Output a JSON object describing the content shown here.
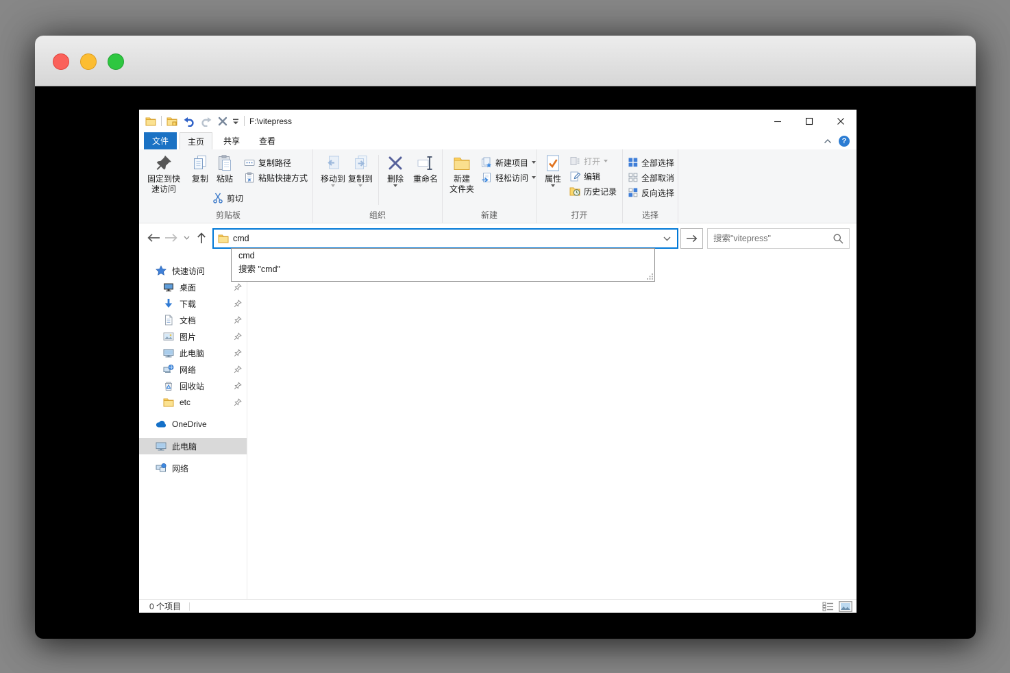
{
  "explorer": {
    "titlebar": {
      "path": "F:\\vitepress"
    },
    "tabs": {
      "file": "文件",
      "home": "主页",
      "share": "共享",
      "view": "查看"
    },
    "ribbon": {
      "clipboard": {
        "label": "剪贴板",
        "pin_line1": "固定到快",
        "pin_line2": "速访问",
        "copy": "复制",
        "paste": "粘贴",
        "cut": "剪切",
        "copy_path": "复制路径",
        "paste_shortcut": "粘贴快捷方式"
      },
      "organize": {
        "label": "组织",
        "move_to": "移动到",
        "copy_to": "复制到",
        "delete": "删除",
        "rename": "重命名"
      },
      "new": {
        "label": "新建",
        "new_folder_line1": "新建",
        "new_folder_line2": "文件夹",
        "new_item": "新建项目",
        "easy_access": "轻松访问"
      },
      "open": {
        "label": "打开",
        "properties": "属性",
        "open": "打开",
        "edit": "编辑",
        "history": "历史记录"
      },
      "select": {
        "label": "选择",
        "select_all": "全部选择",
        "select_none": "全部取消",
        "invert": "反向选择"
      }
    },
    "address_bar": {
      "value": "cmd",
      "search_placeholder": "搜索\"vitepress\""
    },
    "autocomplete": {
      "item1": "cmd",
      "item2": "搜索 \"cmd\""
    },
    "sidebar": {
      "items": [
        {
          "label": "快速访问"
        },
        {
          "label": "桌面"
        },
        {
          "label": "下载"
        },
        {
          "label": "文档"
        },
        {
          "label": "图片"
        },
        {
          "label": "此电脑"
        },
        {
          "label": "网络"
        },
        {
          "label": "回收站"
        },
        {
          "label": "etc"
        },
        {
          "label": "OneDrive"
        },
        {
          "label": "此电脑"
        },
        {
          "label": "网络"
        }
      ]
    },
    "status_bar": {
      "items_count": "0 个项目"
    },
    "help_glyph": "?"
  },
  "colors": {
    "accent_blue": "#0078d7",
    "file_tab_blue": "#1b72c4",
    "traffic_red": "#fa615a",
    "traffic_yellow": "#fcbd32",
    "traffic_green": "#2ec740",
    "selection_gray": "#d9d9d9"
  }
}
